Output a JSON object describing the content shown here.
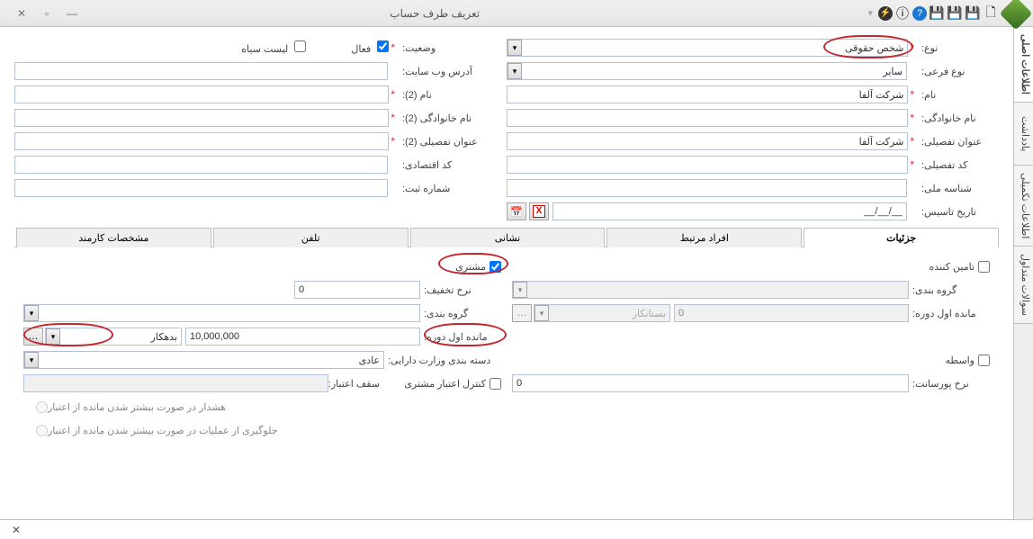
{
  "window": {
    "title": "تعریف طرف حساب"
  },
  "toolbar": {
    "help": "؟",
    "info": "i"
  },
  "side_tabs": [
    {
      "label": "اطلاعات اصلی",
      "active": true
    },
    {
      "label": "یادداشت",
      "active": false
    },
    {
      "label": "اطلاعات تکمیلی",
      "active": false
    },
    {
      "label": "سوالات متداول",
      "active": false
    }
  ],
  "form": {
    "type_label": "نوع:",
    "type_value": "شخص حقوقی",
    "subtype_label": "نوع فرعی:",
    "subtype_value": "سایر",
    "name_label": "نام:",
    "name_value": "شرکت آلفا",
    "lastname_label": "نام خانوادگی:",
    "lastname_value": "",
    "detailtitle_label": "عنوان تفصیلی:",
    "detailtitle_value": "شرکت آلفا",
    "detailcode_label": "کد تفصیلی:",
    "detailcode_value": "",
    "nationalid_label": "شناسه ملی:",
    "nationalid_value": "",
    "founddate_label": "تاریخ تاسیس:",
    "founddate_value": "__/__/__",
    "status_label": "وضعیت:",
    "status_active": "فعال",
    "status_blacklist": "لیست سیاه",
    "website_label": "آدرس وب سایت:",
    "website_value": "",
    "name2_label": "نام (2):",
    "name2_value": "",
    "lastname2_label": "نام خانوادگی (2):",
    "lastname2_value": "",
    "detailtitle2_label": "عنوان تفصیلی (2):",
    "detailtitle2_value": "",
    "econcode_label": "کد اقتصادی:",
    "econcode_value": "",
    "regno_label": "شماره ثبت:",
    "regno_value": ""
  },
  "detail_tabs": [
    {
      "label": "جزئیات",
      "active": true
    },
    {
      "label": "افراد مرتبط",
      "active": false
    },
    {
      "label": "نشانی",
      "active": false
    },
    {
      "label": "تلفن",
      "active": false
    },
    {
      "label": "مشخصات کارمند",
      "active": false
    }
  ],
  "details": {
    "supplier_label": "تامین کننده",
    "customer_label": "مشتری",
    "intermediary_label": "واسطه",
    "grouping_label_r": "گروه بندی:",
    "grouping_value_r": "",
    "opening_balance_label_r": "مانده اول دوره:",
    "opening_balance_value_r": "0",
    "opening_type_r": "بستانکار",
    "commission_rate_label": "نرخ پورسانت:",
    "commission_rate_value": "0",
    "discount_rate_label": "نرخ تخفیف:",
    "discount_rate_value": "0",
    "grouping_label_l": "گروه بندی:",
    "grouping_value_l": "",
    "opening_balance_label_l": "مانده اول دوره:",
    "opening_balance_value_l": "10,000,000",
    "opening_type_l": "بدهکار",
    "tax_category_label": "دسته بندی وزارت دارایی:",
    "tax_category_value": "عادی",
    "credit_control_label": "کنترل اعتبار مشتری",
    "credit_limit_label": "سقف اعتبار:",
    "credit_limit_value": "",
    "warn_option": "هشدار در صورت بیشتر شدن مانده از اعتبار",
    "block_option": "جلوگیری از عملیات در صورت بیشتر شدن مانده از اعتبار"
  }
}
